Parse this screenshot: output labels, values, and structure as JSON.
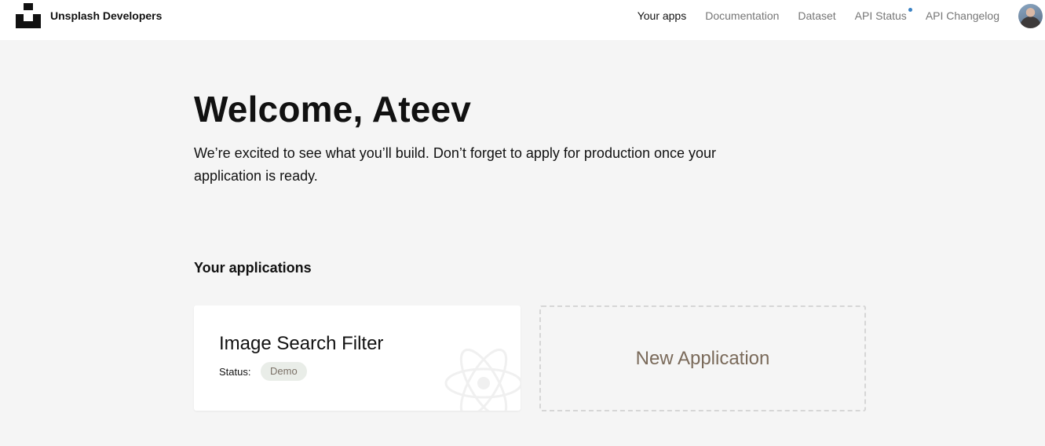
{
  "header": {
    "brand_name": "Unsplash Developers",
    "nav": [
      {
        "label": "Your apps",
        "active": true
      },
      {
        "label": "Documentation"
      },
      {
        "label": "Dataset"
      },
      {
        "label": "API Status",
        "status_dot_color": "#3b82c4"
      },
      {
        "label": "API Changelog"
      }
    ],
    "avatar_icon": "user-avatar"
  },
  "main": {
    "heading": "Welcome, Ateev",
    "intro": "We’re excited to see what you’ll build. Don’t forget to apply for production once your application is ready.",
    "section_title": "Your applications",
    "apps": [
      {
        "name": "Image Search Filter",
        "status_label": "Status:",
        "status": "Demo",
        "icon": "react-atom-icon"
      }
    ],
    "new_app_label": "New Application"
  }
}
